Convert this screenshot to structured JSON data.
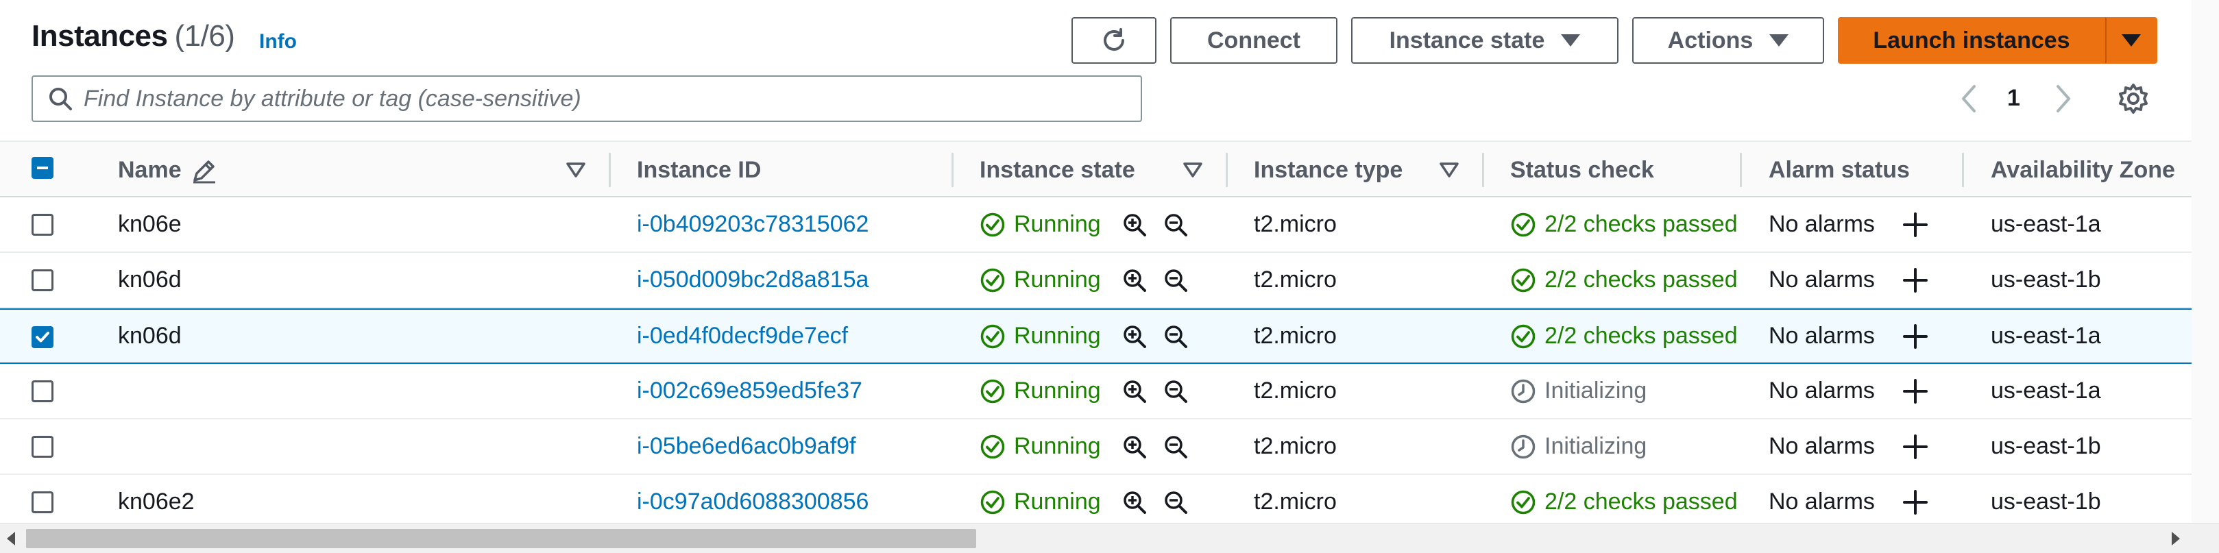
{
  "header": {
    "title": "Instances",
    "count": "(1/6)",
    "info_link": "Info",
    "connect_label": "Connect",
    "instance_state_label": "Instance state",
    "actions_label": "Actions",
    "launch_label": "Launch instances",
    "search_placeholder": "Find Instance by attribute or tag (case-sensitive)",
    "page_number": "1"
  },
  "columns": {
    "name": "Name",
    "instance_id": "Instance ID",
    "instance_state": "Instance state",
    "instance_type": "Instance type",
    "status_check": "Status check",
    "alarm_status": "Alarm status",
    "availability_zone": "Availability Zone"
  },
  "rows": [
    {
      "name": "kn06e",
      "id": "i-0b409203c78315062",
      "state": "Running",
      "type": "t2.micro",
      "status": "2/2 checks passed",
      "status_kind": "ok",
      "alarm": "No alarms",
      "az": "us-east-1a",
      "selected": false
    },
    {
      "name": "kn06d",
      "id": "i-050d009bc2d8a815a",
      "state": "Running",
      "type": "t2.micro",
      "status": "2/2 checks passed",
      "status_kind": "ok",
      "alarm": "No alarms",
      "az": "us-east-1b",
      "selected": false
    },
    {
      "name": "kn06d",
      "id": "i-0ed4f0decf9de7ecf",
      "state": "Running",
      "type": "t2.micro",
      "status": "2/2 checks passed",
      "status_kind": "ok",
      "alarm": "No alarms",
      "az": "us-east-1a",
      "selected": true
    },
    {
      "name": "",
      "id": "i-002c69e859ed5fe37",
      "state": "Running",
      "type": "t2.micro",
      "status": "Initializing",
      "status_kind": "init",
      "alarm": "No alarms",
      "az": "us-east-1a",
      "selected": false
    },
    {
      "name": "",
      "id": "i-05be6ed6ac0b9af9f",
      "state": "Running",
      "type": "t2.micro",
      "status": "Initializing",
      "status_kind": "init",
      "alarm": "No alarms",
      "az": "us-east-1b",
      "selected": false
    },
    {
      "name": "kn06e2",
      "id": "i-0c97a0d6088300856",
      "state": "Running",
      "type": "t2.micro",
      "status": "2/2 checks passed",
      "status_kind": "ok",
      "alarm": "No alarms",
      "az": "us-east-1b",
      "selected": false
    }
  ],
  "icons": {
    "refresh": "refresh-icon",
    "search": "search-icon",
    "edit": "pencil-icon",
    "running": "check-circle-icon",
    "initializing": "clock-icon",
    "zoom_in": "zoom-in-icon",
    "zoom_out": "zoom-out-icon",
    "add_alarm": "plus-icon",
    "settings": "gear-icon"
  },
  "colors": {
    "accent": "#ec7211",
    "link": "#0073bb",
    "success": "#1d8102",
    "muted": "#687078"
  }
}
